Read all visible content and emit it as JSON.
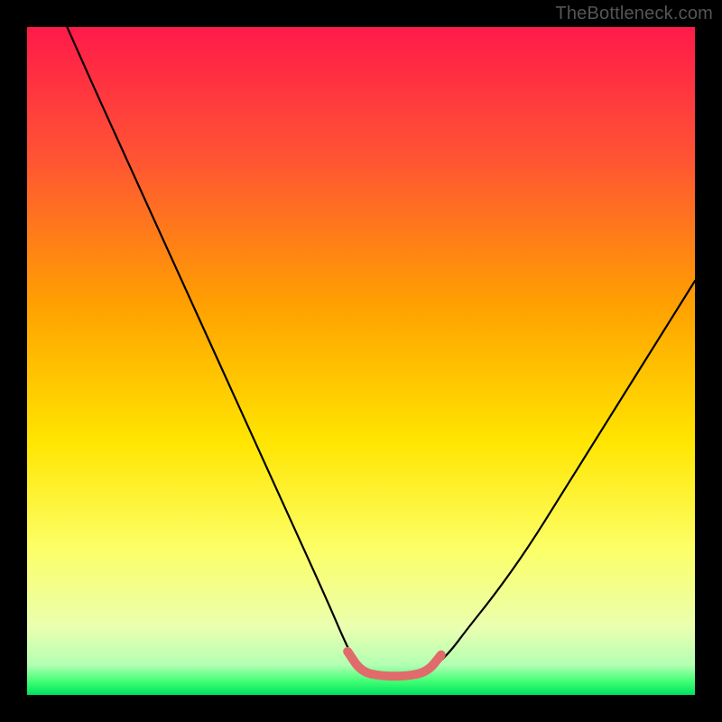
{
  "watermark": "TheBottleneck.com",
  "chart_data": {
    "type": "line",
    "title": "",
    "xlabel": "",
    "ylabel": "",
    "xlim": [
      0,
      100
    ],
    "ylim": [
      0,
      100
    ],
    "grid": false,
    "legend": false,
    "gradient_stops": [
      {
        "offset": 0.0,
        "color": "#ff1a4a"
      },
      {
        "offset": 0.2,
        "color": "#ff5533"
      },
      {
        "offset": 0.42,
        "color": "#ffa200"
      },
      {
        "offset": 0.62,
        "color": "#ffe500"
      },
      {
        "offset": 0.78,
        "color": "#fcff66"
      },
      {
        "offset": 0.9,
        "color": "#eaffb0"
      },
      {
        "offset": 0.955,
        "color": "#b3ffb3"
      },
      {
        "offset": 0.98,
        "color": "#40ff73"
      },
      {
        "offset": 1.0,
        "color": "#00e060"
      }
    ],
    "series": [
      {
        "name": "left-branch",
        "x": [
          6,
          10,
          15,
          20,
          25,
          30,
          35,
          40,
          45,
          48,
          50
        ],
        "y": [
          100,
          91,
          80,
          69,
          58,
          47,
          36,
          25,
          14,
          7,
          3.5
        ]
      },
      {
        "name": "right-branch",
        "x": [
          60,
          63,
          66,
          70,
          75,
          80,
          85,
          90,
          95,
          100
        ],
        "y": [
          3.5,
          6,
          10,
          15,
          22,
          30,
          38,
          46,
          54,
          62
        ]
      },
      {
        "name": "valley-highlight",
        "x": [
          48,
          50,
          53,
          57,
          60,
          62
        ],
        "y": [
          6.5,
          3.5,
          2.8,
          2.8,
          3.5,
          6.0
        ],
        "stroke": "#e16b6b",
        "stroke_width": 10
      }
    ]
  }
}
